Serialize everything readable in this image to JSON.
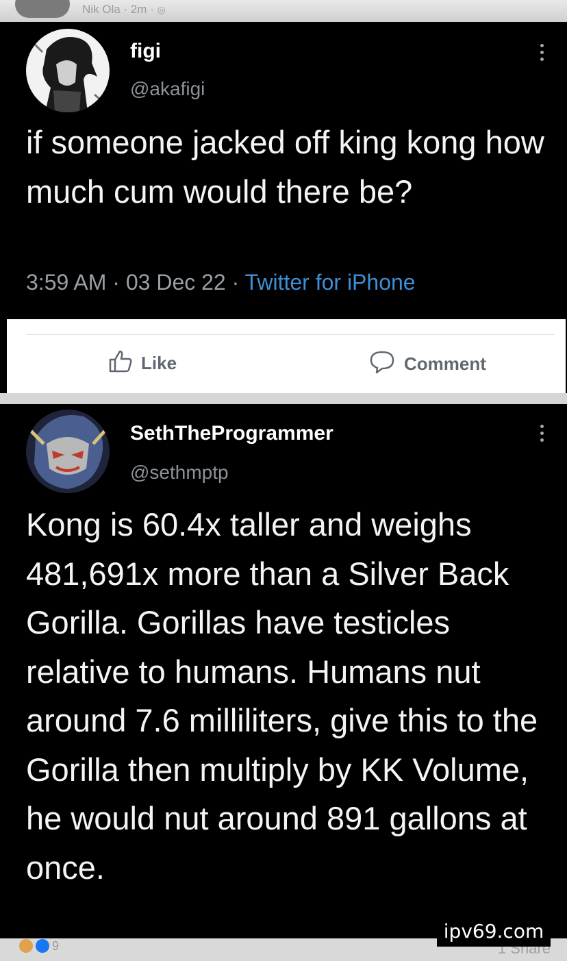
{
  "facebook": {
    "post_author": "Nik Ola",
    "post_time": "2m",
    "reaction_count": "9",
    "share_label": "Share",
    "like_label": "Like",
    "comment_label": "Comment"
  },
  "tweets": [
    {
      "display_name": "figi",
      "handle": "@akafigi",
      "text": "if someone jacked off king kong how much cum would there be?",
      "time": "3:59 AM",
      "date": "03 Dec 22",
      "source": "Twitter for iPhone"
    },
    {
      "display_name": "SethTheProgrammer",
      "handle": "@sethmptp",
      "text": "Kong is 60.4x taller and weighs 481,691x more than a Silver Back Gorilla.  Gorillas have testicles relative to humans.  Humans nut around 7.6 milliliters, give this to the Gorilla then multiply by KK Volume, he would nut around 891 gallons at once."
    }
  ],
  "watermark": "ipv69.com",
  "colors": {
    "background": "#000000",
    "link": "#3f8fd6",
    "muted": "#9aa0a6",
    "fb_bar": "#ffffff"
  }
}
